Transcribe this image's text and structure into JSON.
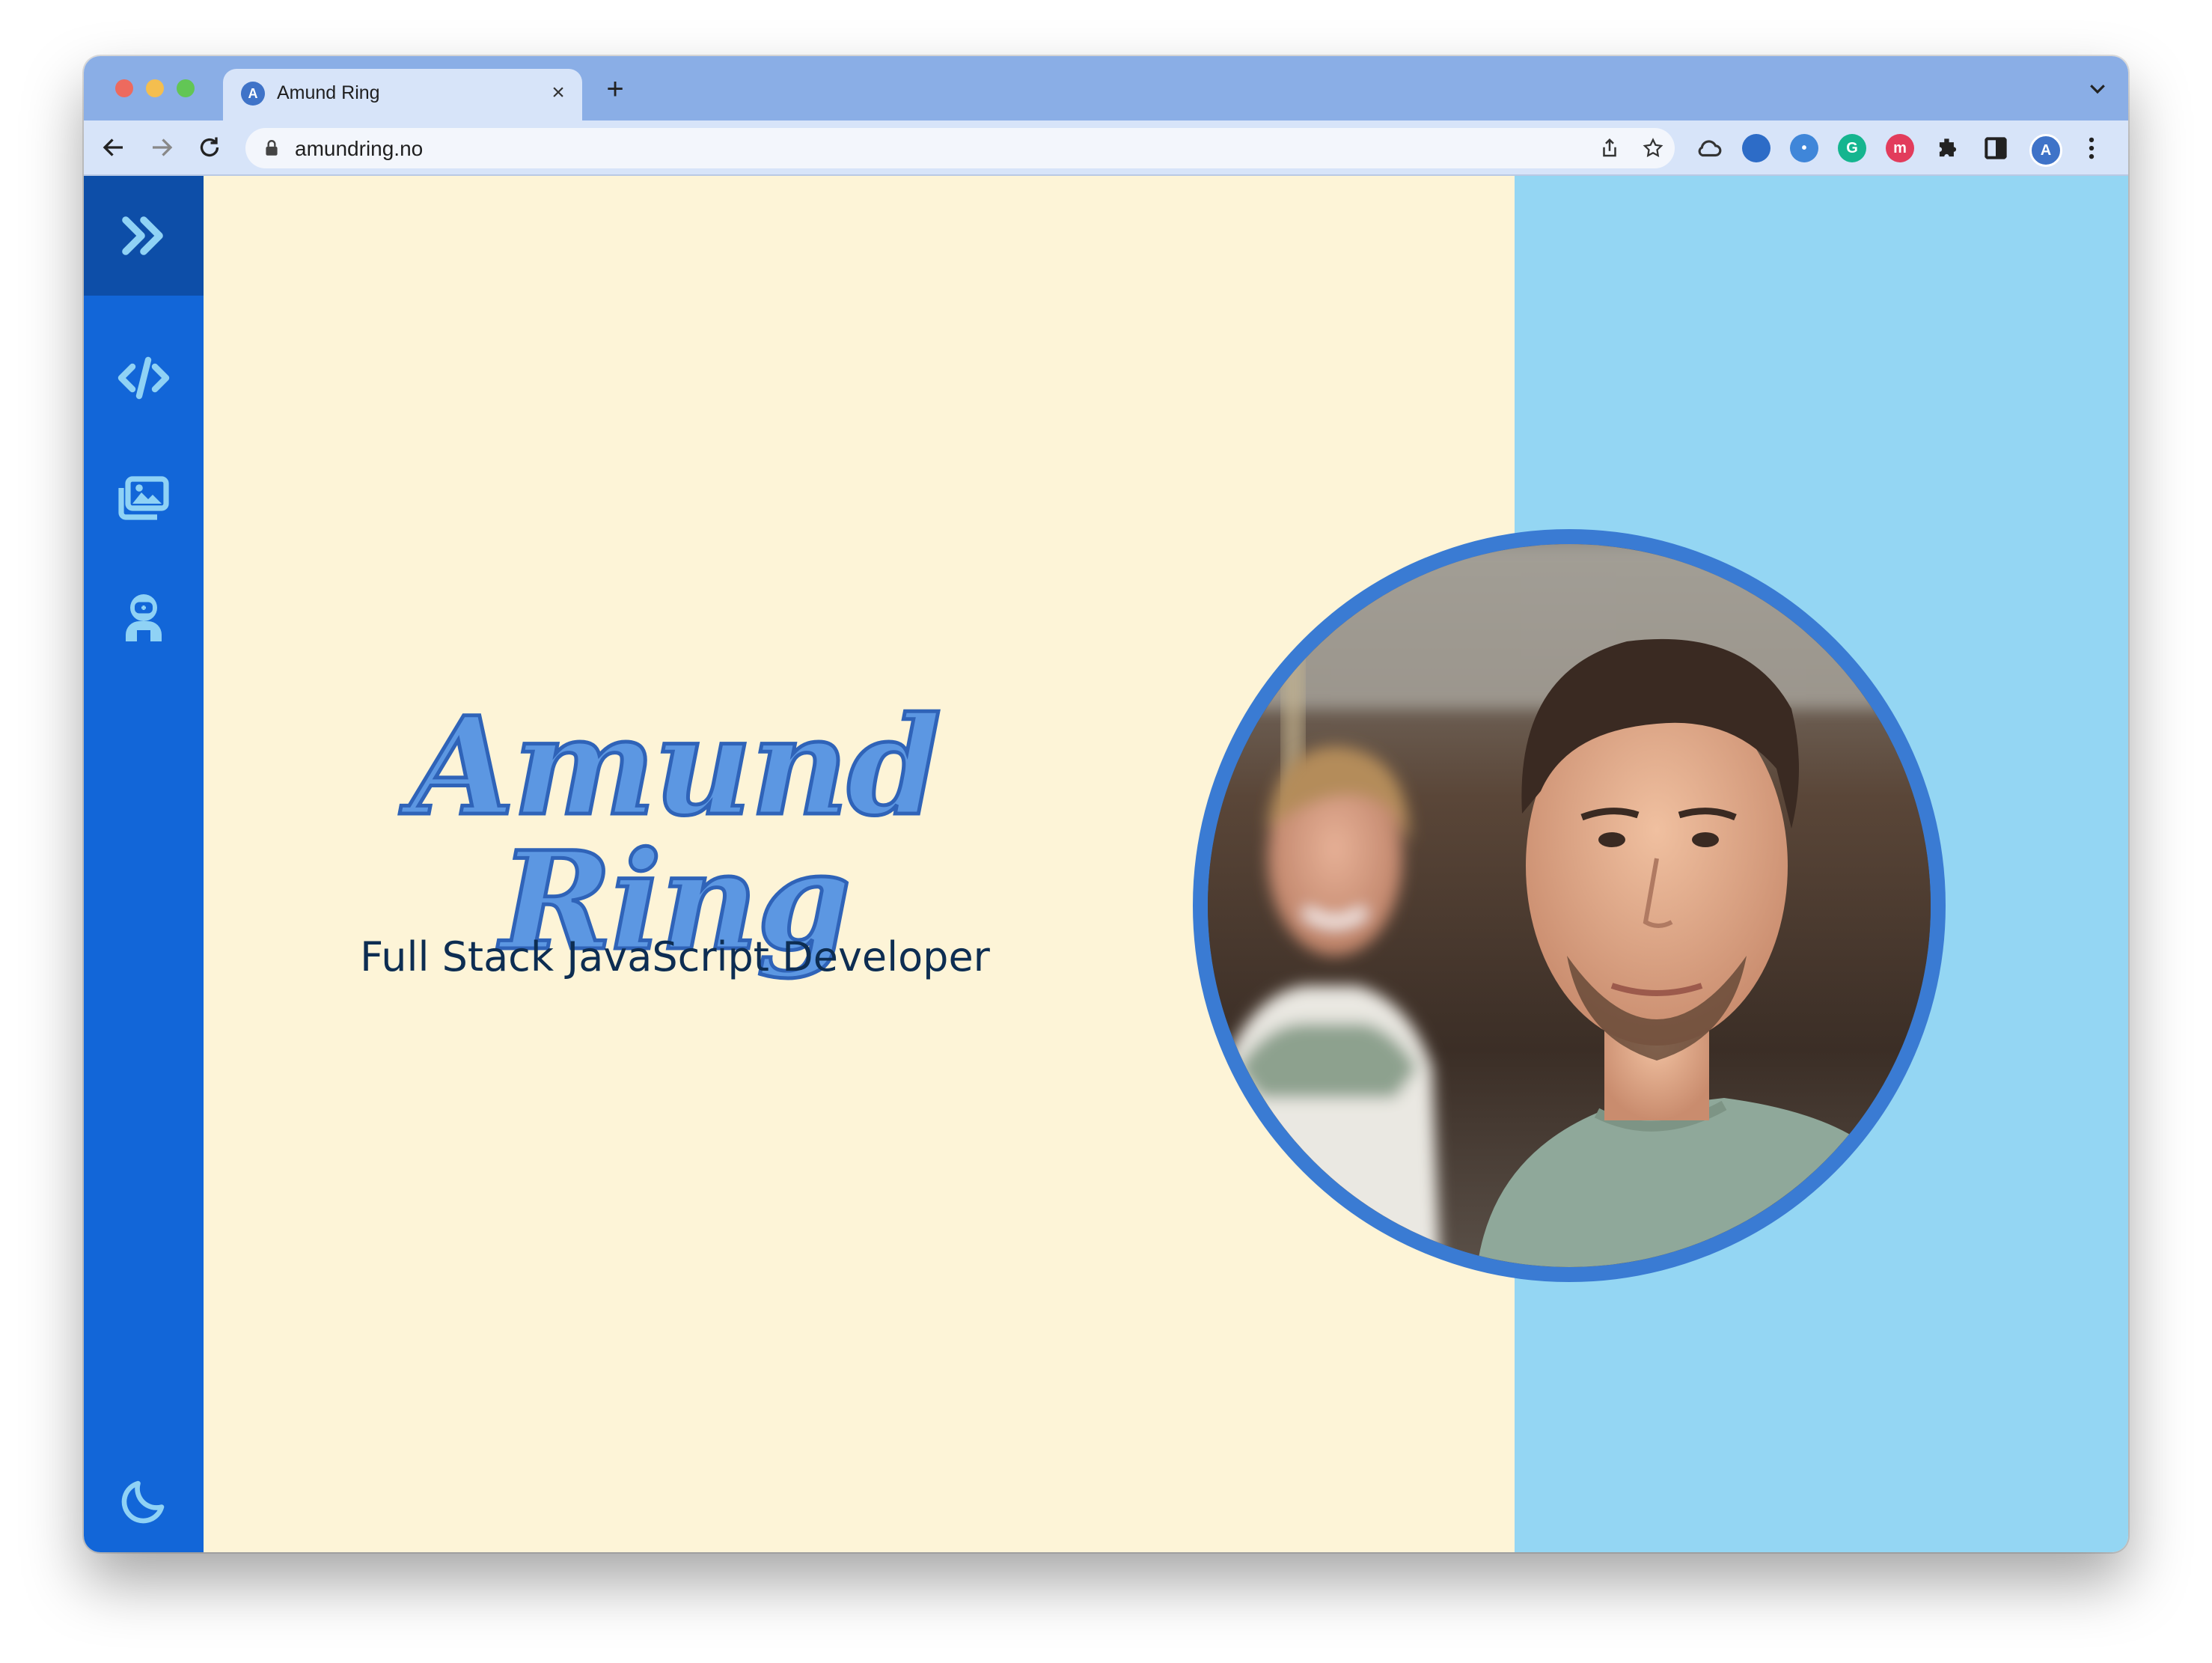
{
  "browser": {
    "tab_title": "Amund Ring",
    "tab_favicon_letter": "A",
    "new_tab_symbol": "+",
    "close_symbol": "×",
    "url": "amundring.no",
    "profile_letter": "A"
  },
  "sidebar": {
    "items": [
      {
        "icon": "double-chevron-right-icon"
      },
      {
        "icon": "code-icon"
      },
      {
        "icon": "gallery-icon"
      },
      {
        "icon": "astronaut-icon"
      },
      {
        "icon": "moon-icon"
      }
    ]
  },
  "hero": {
    "name": "Amund Ring",
    "subtitle": "Full Stack JavaScript Developer"
  },
  "colors": {
    "sidebar": "#1266d8",
    "sidebar_top": "#0d4ea8",
    "cream": "#fdf4d7",
    "sky": "#94d6f3",
    "name": "#5c97e2",
    "accent_ring": "#3a7bd3"
  }
}
